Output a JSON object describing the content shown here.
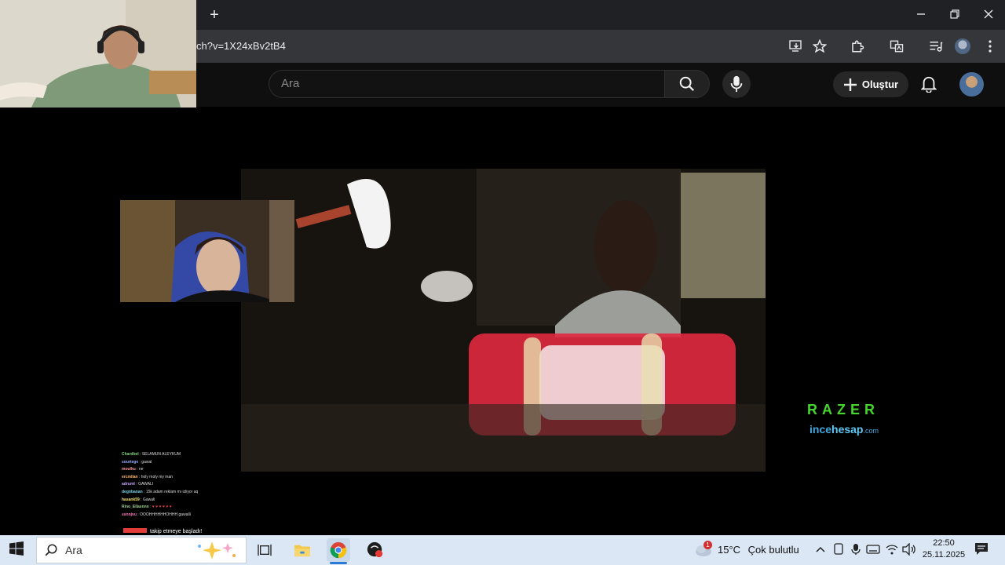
{
  "browser": {
    "url": "ch?v=1X24xBv2tB4",
    "new_tab_icon": "plus-icon"
  },
  "youtube": {
    "search_placeholder": "Ara",
    "create_label": "Oluştur"
  },
  "stream": {
    "chat": [
      {
        "name": "Chardbel",
        "msg": "SELAMUN ALEYKUM",
        "color": "#7fd67f"
      },
      {
        "name": "sourtege",
        "msg": "gawal",
        "color": "#9ab0ff"
      },
      {
        "name": "moulku",
        "msg": "ne",
        "color": "#ff9a9a"
      },
      {
        "name": "ercmilan",
        "msg": "holy moly my man",
        "color": "#ffb86b"
      },
      {
        "name": "adrumt",
        "msg": "GAWALI",
        "color": "#c7a3ff"
      },
      {
        "name": "degnbanan",
        "msg": "15k adam reklam mı izliyor aq",
        "color": "#79d3e6"
      },
      {
        "name": "hasank59",
        "msg": "Gawali",
        "color": "#f0e06c"
      },
      {
        "name": "Rino_Ellasnnn",
        "msg": "",
        "color": "#9ad08e"
      },
      {
        "name": "ssnnjvu",
        "msg": "OOOHHHHHHOHHH gawalli",
        "color": "#ff7bbf"
      }
    ],
    "follow_name": "",
    "follow_text": "takip etmeye başladı!"
  },
  "sponsor": {
    "brand": "RAZER",
    "site_a": "ince",
    "site_b": "hesap",
    "site_c": ".com"
  },
  "taskbar": {
    "search_text": "Ara",
    "weather_temp": "15°C",
    "weather_desc": "Çok bulutlu",
    "weather_badge": "1",
    "time": "22:50",
    "date": "25.11.2025"
  },
  "colors": {
    "taskbar_bg": "#dbe7f5",
    "razer_green": "#44d62c"
  }
}
